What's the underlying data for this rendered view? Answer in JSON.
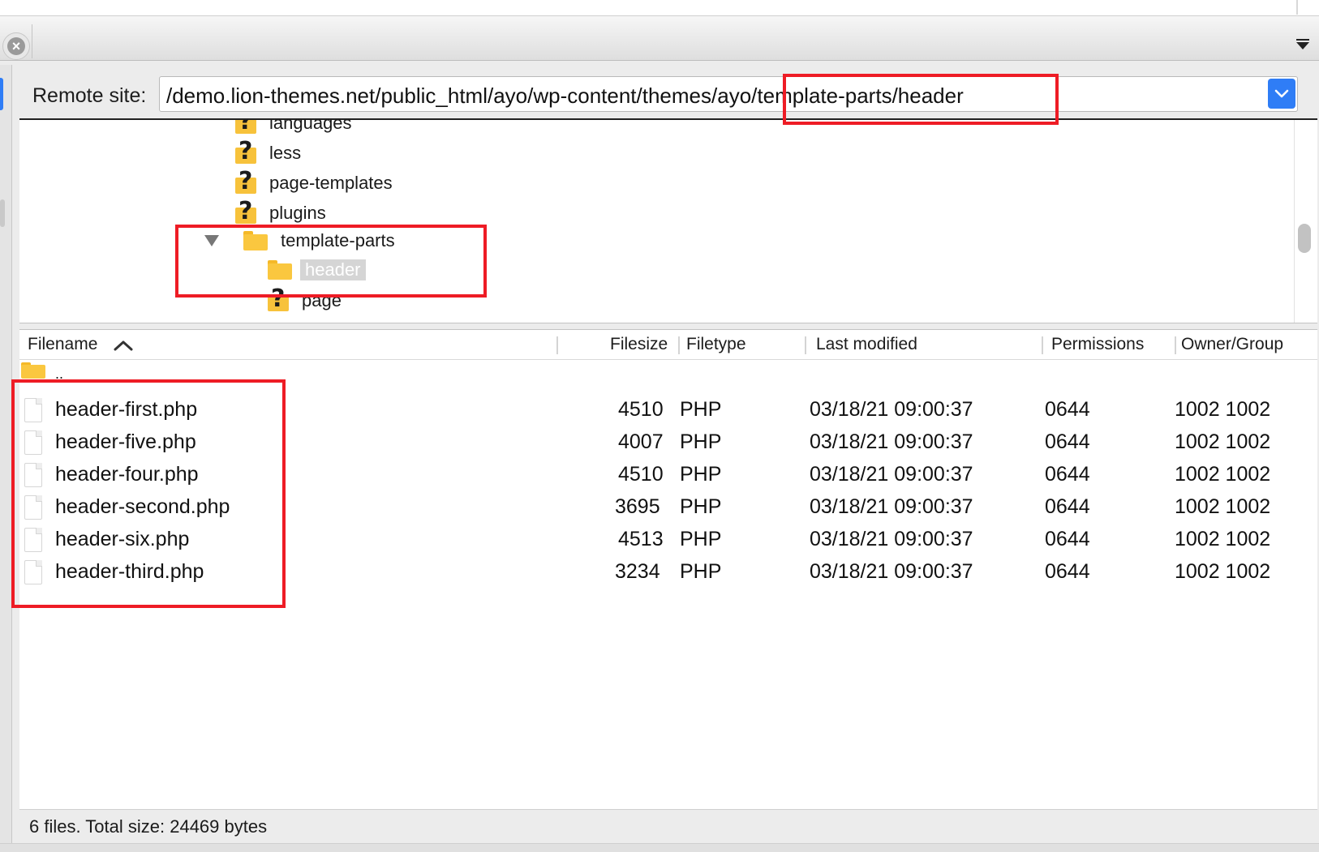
{
  "remote_site": {
    "label": "Remote site:",
    "path": "/demo.lion-themes.net/public_html/ayo/wp-content/themes/ayo/template-parts/header"
  },
  "tree": {
    "items": [
      {
        "label": "languages",
        "icon": "unknown-folder-icon"
      },
      {
        "label": "less",
        "icon": "unknown-folder-icon"
      },
      {
        "label": "page-templates",
        "icon": "unknown-folder-icon"
      },
      {
        "label": "plugins",
        "icon": "unknown-folder-icon"
      },
      {
        "label": "template-parts",
        "icon": "folder-icon",
        "expanded": true
      },
      {
        "label": "header",
        "icon": "folder-icon",
        "selected": true
      },
      {
        "label": "page",
        "icon": "unknown-folder-icon"
      }
    ]
  },
  "file_list": {
    "columns": {
      "filename": "Filename",
      "filesize": "Filesize",
      "filetype": "Filetype",
      "last_modified": "Last modified",
      "permissions": "Permissions",
      "owner_group": "Owner/Group"
    },
    "parent_dir": "..",
    "rows": [
      {
        "name": "header-first.php",
        "size": "4510",
        "type": "PHP",
        "modified": "03/18/21 09:00:37",
        "perm": "0644",
        "owner": "1002 1002"
      },
      {
        "name": "header-five.php",
        "size": "4007",
        "type": "PHP",
        "modified": "03/18/21 09:00:37",
        "perm": "0644",
        "owner": "1002 1002"
      },
      {
        "name": "header-four.php",
        "size": "4510",
        "type": "PHP",
        "modified": "03/18/21 09:00:37",
        "perm": "0644",
        "owner": "1002 1002"
      },
      {
        "name": "header-second.php",
        "size": "3695",
        "type": "PHP",
        "modified": "03/18/21 09:00:37",
        "perm": "0644",
        "owner": "1002 1002"
      },
      {
        "name": "header-six.php",
        "size": "4513",
        "type": "PHP",
        "modified": "03/18/21 09:00:37",
        "perm": "0644",
        "owner": "1002 1002"
      },
      {
        "name": "header-third.php",
        "size": "3234",
        "type": "PHP",
        "modified": "03/18/21 09:00:37",
        "perm": "0644",
        "owner": "1002 1002"
      }
    ]
  },
  "status": {
    "text": "6 files. Total size: 24469 bytes"
  },
  "colors": {
    "accent": "#2f7df6",
    "annotation": "#ee1c25",
    "folder": "#fac73f"
  }
}
